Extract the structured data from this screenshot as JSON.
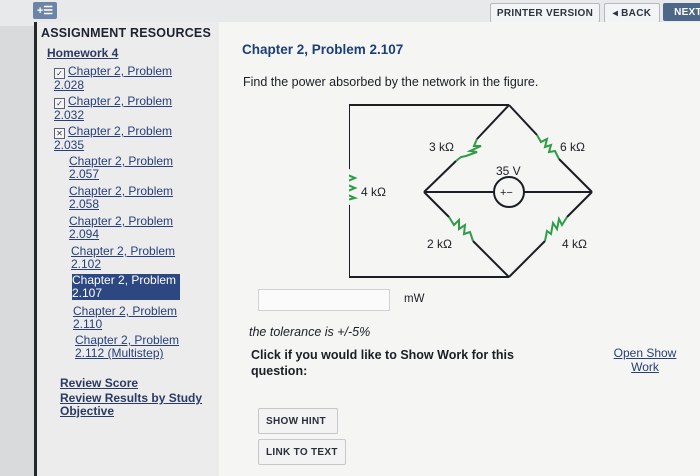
{
  "toolbar": {
    "expand_label": "+☰",
    "printer_label": "PRINTER VERSION",
    "back_label": "◂ BACK",
    "next_label": "NEXT"
  },
  "sidebar": {
    "title": "ASSIGNMENT RESOURCES",
    "homework": "Homework 4",
    "items": [
      {
        "label": "Chapter 2, Problem 2.028",
        "line1": "Chapter 2, Problem",
        "line2": "2.028",
        "status": "✓"
      },
      {
        "label": "Chapter 2, Problem 2.032",
        "line1": "Chapter 2, Problem",
        "line2": "2.032",
        "status": "✓"
      },
      {
        "label": "Chapter 2, Problem 2.035",
        "line1": "Chapter 2, Problem",
        "line2": "2.035",
        "status": "✕"
      },
      {
        "label": "Chapter 2, Problem 2.057",
        "line1": "Chapter 2, Problem",
        "line2": "2.057"
      },
      {
        "label": "Chapter 2, Problem 2.058",
        "line1": "Chapter 2, Problem",
        "line2": "2.058"
      },
      {
        "label": "Chapter 2, Problem 2.094",
        "line1": "Chapter 2, Problem",
        "line2": "2.094"
      },
      {
        "label": "Chapter 2, Problem 2.102",
        "line1": "Chapter 2, Problem",
        "line2": "2.102"
      },
      {
        "label": "Chapter 2, Problem 2.107",
        "line1": "Chapter 2, Problem",
        "line2": "2.107"
      },
      {
        "label": "Chapter 2, Problem 2.110",
        "line1": "Chapter 2, Problem",
        "line2": "2.110"
      },
      {
        "label": "Chapter 2, Problem 2.112 (Multistep)",
        "line1": "Chapter 2, Problem",
        "line2": "2.112 (Multistep)"
      }
    ],
    "review_score": "Review Score",
    "review_results": "Review Results by Study Objective",
    "review_results_l1": "Review Results by Study",
    "review_results_l2": "Objective"
  },
  "main": {
    "title": "Chapter 2, Problem 2.107",
    "question": "Find the power absorbed by the network in the figure.",
    "answer_value": "",
    "answer_unit": "mW",
    "tolerance": "the tolerance is +/-5%",
    "show_work_prompt": "Click if you would like to Show Work for this question:",
    "show_work_link_l1": "Open Show",
    "show_work_link_l2": "Work",
    "hint_button": "SHOW HINT",
    "link_text_button": "LINK TO TEXT"
  },
  "circuit": {
    "r_left": "4 kΩ",
    "r_top_left": "3 kΩ",
    "r_top_right": "6 kΩ",
    "r_bottom_left": "2 kΩ",
    "r_bottom_right": "4 kΩ",
    "source": "35 V",
    "source_symbol": "+−"
  },
  "colors": {
    "accent_blue": "#1c3f78",
    "link_blue": "#27407a",
    "current_item_bg": "#2c4781",
    "next_button": "#4e6788"
  }
}
